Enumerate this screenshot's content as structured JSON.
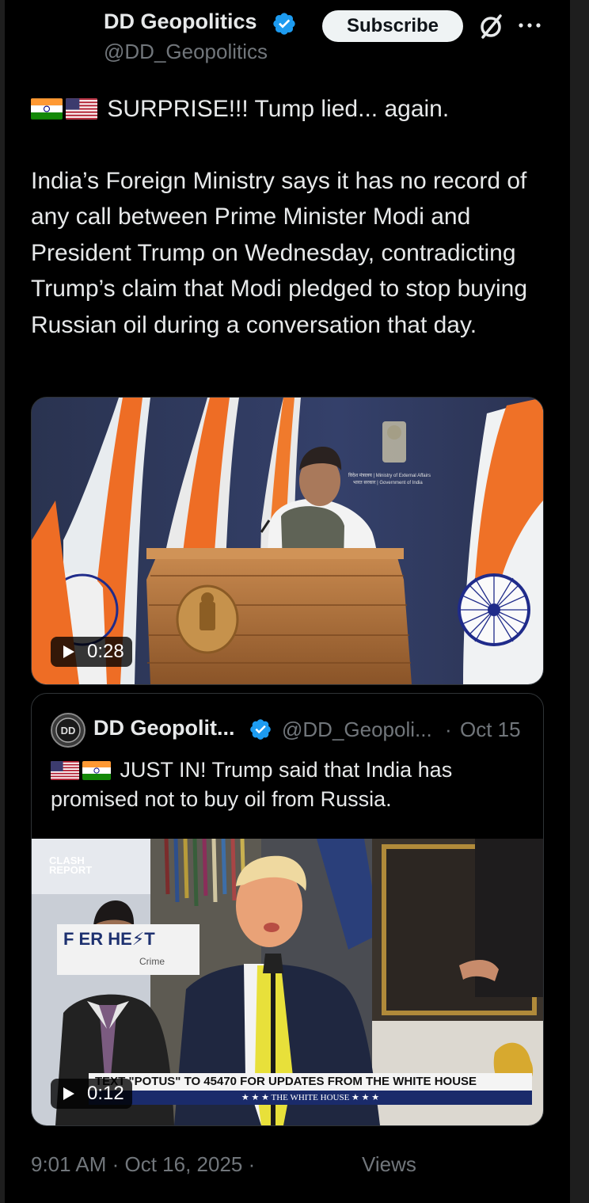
{
  "post": {
    "author_name": "DD Geopolitics",
    "author_handle": "@DD_Geopolitics",
    "subscribe_label": "Subscribe",
    "icons": [
      "verified-badge-icon",
      "grok-icon",
      "more-options-icon"
    ],
    "text_line1": "SURPRISE!!! Tump lied... again.",
    "text_body": "India’s Foreign Ministry says it has no record of any call between Prime Minister Modi and President Trump on Wednesday, contradicting Trump’s claim that Modi pledged to stop buying Russian oil during a conversation that day.",
    "video": {
      "duration": "0:28",
      "sign_line1": "विदेश मंत्रालय | Ministry of External Affairs",
      "sign_line2": "भारत सरकार | Government of India"
    },
    "timestamp": "9:01 AM · Oct 16, 2025 ·",
    "views_label": "Views"
  },
  "quote": {
    "author_name": "DD Geopolit...",
    "author_handle": "@DD_Geopoli...",
    "separator": "·",
    "date": "Oct 15",
    "avatar_text": "DD",
    "text": "JUST IN! Trump said that India has promised not to buy oil from Russia.",
    "video": {
      "duration": "0:12",
      "logo_line1": "CLASH",
      "logo_line2": "REPORT",
      "sign_text": "F     ER HE⚡T",
      "sign_sub": "Crime",
      "chyron_top": "TEXT \"POTUS\" TO 45470 FOR UPDATES FROM THE WHITE HOUSE",
      "chyron_bottom": "★ ★ ★   THE WHITE HOUSE   ★ ★ ★"
    }
  },
  "colors": {
    "background": "#000000",
    "text": "#e7e9ea",
    "muted": "#71767b",
    "verified": "#1d9bf0",
    "border": "#2f3336"
  }
}
